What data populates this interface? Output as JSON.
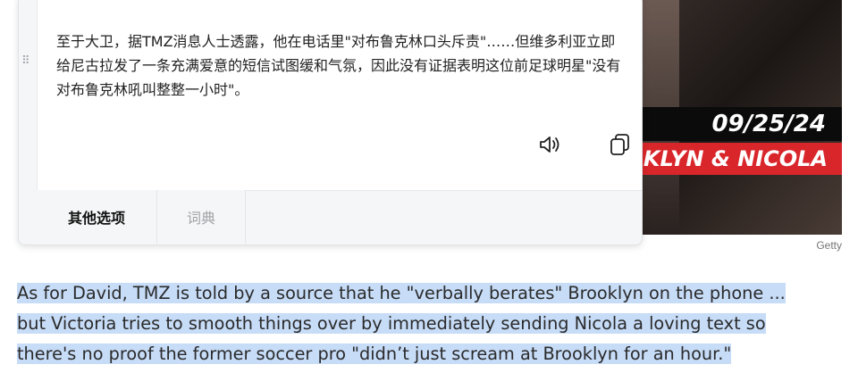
{
  "popup": {
    "translation_text": "至于大卫，据TMZ消息人士透露，他在电话里\"对布鲁克林口头斥责\"……但维多利亚立即给尼古拉发了一条充满爱意的短信试图缓和气氛，因此没有证据表明这位前足球明星\"没有对布鲁克林吼叫整整一小时\"。",
    "actions": {
      "speaker_icon": "speaker-icon",
      "copy_icon": "copy-icon"
    },
    "tabs": [
      {
        "label": "其他选项",
        "active": true
      },
      {
        "label": "词典",
        "active": false
      }
    ]
  },
  "photo": {
    "date_text": "09/25/24",
    "name_text": "KLYN & NICOLA",
    "credit": "Getty",
    "banner_color": "#d8262b"
  },
  "article": {
    "lines": [
      "As for David, TMZ is told by a source that he \"verbally berates\" Brooklyn on the phone ...",
      "but Victoria tries to smooth things over by immediately sending Nicola a loving text so",
      "there's no proof the former soccer pro \"didn’t just scream at Brooklyn for an hour.\""
    ],
    "highlight_color": "#c7dcf7"
  }
}
